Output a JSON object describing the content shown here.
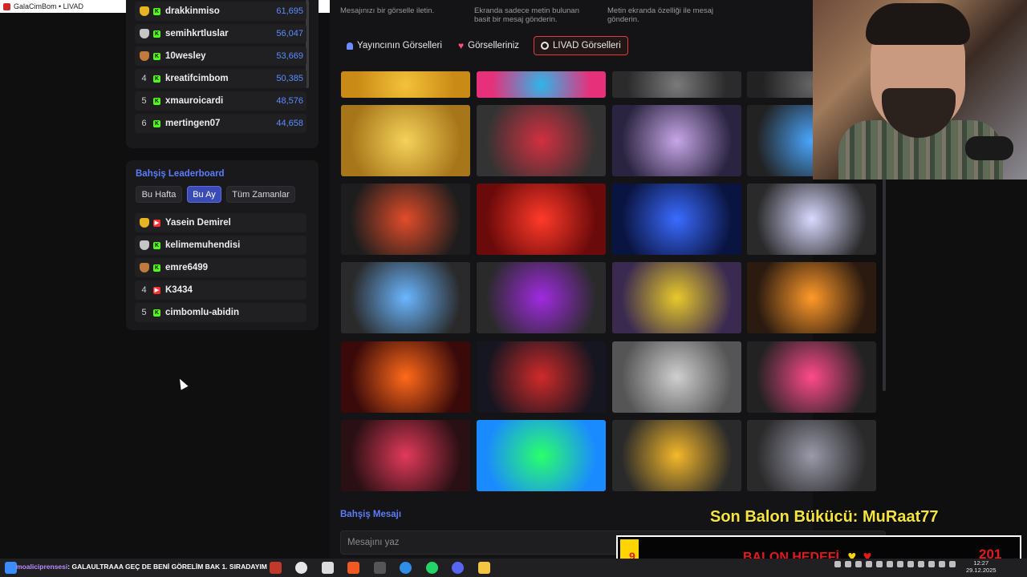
{
  "window": {
    "title": "GalaCimBom • LIVAD"
  },
  "top_leaderboard": {
    "rows": [
      {
        "rank": "",
        "medal": "gold",
        "platform": "kick",
        "name": "drakkinmiso",
        "score": "61,695"
      },
      {
        "rank": "",
        "medal": "silver",
        "platform": "kick",
        "name": "semihkrtluslar",
        "score": "56,047"
      },
      {
        "rank": "",
        "medal": "bronze",
        "platform": "kick",
        "name": "10wesley",
        "score": "53,669"
      },
      {
        "rank": "4",
        "medal": "",
        "platform": "kick",
        "name": "kreatifcimbom",
        "score": "50,385"
      },
      {
        "rank": "5",
        "medal": "",
        "platform": "kick",
        "name": "xmauroicardi",
        "score": "48,576"
      },
      {
        "rank": "6",
        "medal": "",
        "platform": "kick",
        "name": "mertingen07",
        "score": "44,658"
      }
    ]
  },
  "tip_leaderboard": {
    "title": "Bahşiş Leaderboard",
    "tabs": [
      {
        "label": "Bu Hafta",
        "active": false
      },
      {
        "label": "Bu Ay",
        "active": true
      },
      {
        "label": "Tüm Zamanlar",
        "active": false
      }
    ],
    "rows": [
      {
        "rank": "",
        "medal": "gold",
        "platform": "yt",
        "name": "Yasein Demirel"
      },
      {
        "rank": "",
        "medal": "silver",
        "platform": "kick",
        "name": "kelimemuhendisi"
      },
      {
        "rank": "",
        "medal": "bronze",
        "platform": "kick",
        "name": "emre6499"
      },
      {
        "rank": "4",
        "medal": "",
        "platform": "yt",
        "name": "K3434"
      },
      {
        "rank": "5",
        "medal": "",
        "platform": "kick",
        "name": "cimbomlu-abidin"
      }
    ]
  },
  "main": {
    "descriptions": [
      "Mesajınızı bir görselle iletin.",
      "Ekranda sadece metin bulunan basit bir mesaj gönderin.",
      "Metin ekranda özelliği ile mesaj gönderin."
    ],
    "gallery_tabs": [
      {
        "label": "Yayıncının Görselleri",
        "icon": "user-icon",
        "active": false
      },
      {
        "label": "Görselleriniz",
        "icon": "heart-icon",
        "active": false
      },
      {
        "label": "LIVAD Görselleri",
        "icon": "target-icon",
        "active": true
      }
    ],
    "gallery": [
      {
        "name": "gold-sparkle-effect",
        "colors": [
          "#c98a16",
          "#f3c23a"
        ]
      },
      {
        "name": "colorful-balls-effect",
        "colors": [
          "#e6307a",
          "#2fb6e8"
        ]
      },
      {
        "name": "grey-smoke-effect",
        "colors": [
          "#2b2b2b",
          "#7a7a7a"
        ]
      },
      {
        "name": "confetti-dots-effect",
        "colors": [
          "#222",
          "#666"
        ]
      },
      {
        "name": "gold-coins-effect",
        "colors": [
          "#a7761a",
          "#f4d25a"
        ]
      },
      {
        "name": "anime-sailor-effect",
        "colors": [
          "#333",
          "#d23040"
        ]
      },
      {
        "name": "hologram-girl-effect",
        "colors": [
          "#2a2440",
          "#c6a6e6"
        ]
      },
      {
        "name": "blue-particles-effect",
        "colors": [
          "#222",
          "#4aa7ff"
        ]
      },
      {
        "name": "fireworks-effect",
        "colors": [
          "#1d1d1d",
          "#e24c2a"
        ]
      },
      {
        "name": "red-burst-effect",
        "colors": [
          "#6a0a0a",
          "#ff3a2a"
        ]
      },
      {
        "name": "evil-eye-effect",
        "colors": [
          "#0a1440",
          "#3b6bff"
        ]
      },
      {
        "name": "lightning-effect",
        "colors": [
          "#2a2a2a",
          "#d9d9ff"
        ]
      },
      {
        "name": "balloons-effect",
        "colors": [
          "#2a2a2a",
          "#6ab6ff"
        ]
      },
      {
        "name": "motorcycle-rider-effect",
        "colors": [
          "#2a2a2a",
          "#a02ae0"
        ]
      },
      {
        "name": "party-balloons-effect",
        "colors": [
          "#3a2a50",
          "#e8c92a"
        ]
      },
      {
        "name": "fire-orbs-effect",
        "colors": [
          "#2a1a10",
          "#ff9a2a"
        ]
      },
      {
        "name": "dragons-fire-effect",
        "colors": [
          "#3a0a0a",
          "#ff6a1a"
        ]
      },
      {
        "name": "superhero-effect",
        "colors": [
          "#161620",
          "#d02a2a"
        ]
      },
      {
        "name": "spotlight-ring-effect",
        "colors": [
          "#555",
          "#cfcfcf"
        ]
      },
      {
        "name": "colorful-confetti-effect",
        "colors": [
          "#222",
          "#ff4a8a"
        ]
      },
      {
        "name": "rose-petals-effect",
        "colors": [
          "#2a1014",
          "#e23a5a"
        ]
      },
      {
        "name": "rainbow-smoke-effect",
        "colors": [
          "#1a8aff",
          "#2aff6a"
        ]
      },
      {
        "name": "sports-car-effect",
        "colors": [
          "#2a2a2a",
          "#f4b82a"
        ]
      },
      {
        "name": "dancing-cat-effect",
        "colors": [
          "#2a2a2a",
          "#9a9aaa"
        ]
      }
    ],
    "message_title": "Bahşiş Mesajı",
    "message_placeholder": "Mesajını yaz"
  },
  "overlay": {
    "title": "Son Balon Bükücü: MuRaat77",
    "goal_start": "9",
    "goal_label": "BALON HEDEFİ",
    "goal_target": "201",
    "goal_progress": 0.045
  },
  "taskbar": {
    "ticker_user": "moaliciprensesi",
    "ticker_text": ": GALAULTRAAA GEÇ DE BENİ GÖRELİM BAK 1. SIRADAYIM",
    "time": "12:27",
    "date": "29.12.2025"
  }
}
